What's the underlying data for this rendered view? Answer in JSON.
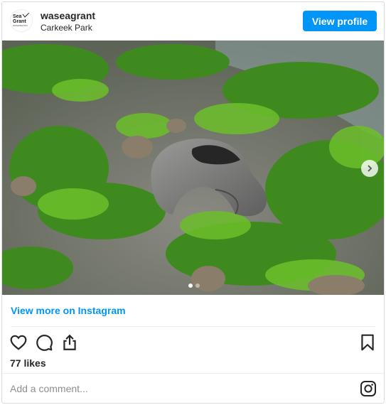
{
  "header": {
    "avatar_lines": [
      "Sea",
      "Grant",
      "WASHINGTON"
    ],
    "username": "waseagrant",
    "location": "Carkeek Park",
    "view_profile_label": "View profile"
  },
  "photo": {
    "alt_icon": "moon-snail-shell-photo",
    "carousel_total": 2,
    "carousel_active": 1
  },
  "view_more_label": "View more on Instagram",
  "likes_text": "77 likes",
  "comment_placeholder": "Add a comment...",
  "colors": {
    "accent": "#0095f6",
    "text": "#262626",
    "muted": "#8e8e8e",
    "border": "#dbdbdb"
  },
  "icons": [
    "heart-icon",
    "comment-icon",
    "share-icon",
    "bookmark-icon",
    "instagram-icon",
    "chevron-right-icon"
  ]
}
